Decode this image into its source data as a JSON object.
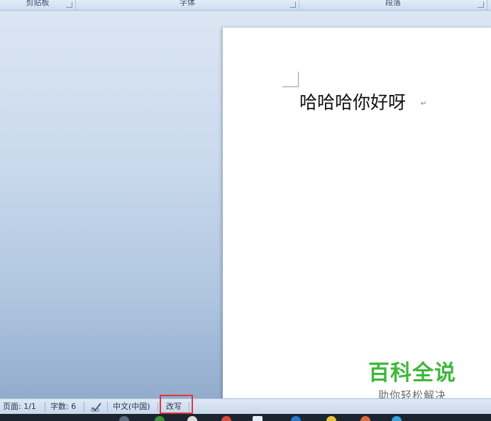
{
  "ribbon": {
    "groups": [
      {
        "label": "剪贴板"
      },
      {
        "label": "字体"
      },
      {
        "label": "段落"
      }
    ]
  },
  "document": {
    "text": "哈哈哈你好呀",
    "paragraph_mark": "↵"
  },
  "watermark": {
    "title": "百科全说",
    "subtitle": "助你轻松解决"
  },
  "statusbar": {
    "page": "页面: 1/1",
    "word_count": "字数: 6",
    "language": "中文(中国)",
    "overtype_mode": "改写"
  },
  "colors": {
    "highlight_box": "#e0373a",
    "watermark_green": "#3db83a"
  },
  "taskbar": {
    "icons": [
      "app-icon",
      "app-icon",
      "app-icon",
      "app-icon",
      "app-icon",
      "app-icon",
      "app-icon",
      "app-icon",
      "app-icon",
      "app-icon",
      "app-icon",
      "app-icon"
    ]
  }
}
